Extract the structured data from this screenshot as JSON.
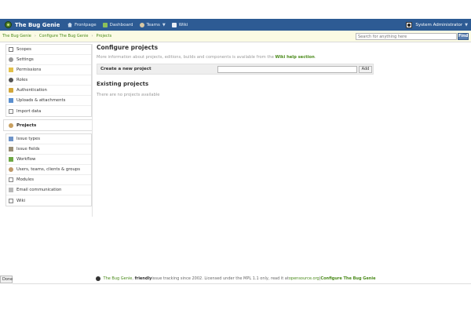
{
  "header": {
    "logo_text": "The Bug Genie",
    "nav": [
      {
        "label": "Frontpage"
      },
      {
        "label": "Dashboard"
      },
      {
        "label": "Teams"
      },
      {
        "label": "Wiki"
      }
    ],
    "user_label": "System Administrator"
  },
  "breadcrumb": {
    "items": [
      "The Bug Genie",
      "Configure The Bug Genie",
      "Projects"
    ],
    "separator": "›"
  },
  "search": {
    "placeholder": "Search for anything here",
    "button_label": "Find"
  },
  "sidebar": {
    "group1": [
      {
        "label": "Scopes",
        "icon": "scopes-icon"
      },
      {
        "label": "Settings",
        "icon": "settings-icon"
      },
      {
        "label": "Permissions",
        "icon": "permissions-icon"
      },
      {
        "label": "Roles",
        "icon": "roles-icon"
      },
      {
        "label": "Authentication",
        "icon": "lock-icon"
      },
      {
        "label": "Uploads & attachments",
        "icon": "upload-icon"
      },
      {
        "label": "Import data",
        "icon": "import-icon"
      }
    ],
    "selected": {
      "label": "Projects",
      "icon": "projects-icon"
    },
    "group2": [
      {
        "label": "Issue types",
        "icon": "issue-types-icon"
      },
      {
        "label": "Issue fields",
        "icon": "issue-fields-icon"
      },
      {
        "label": "Workflow",
        "icon": "workflow-icon"
      },
      {
        "label": "Users, teams, clients & groups",
        "icon": "users-icon"
      },
      {
        "label": "Modules",
        "icon": "modules-icon"
      },
      {
        "label": "Email communication",
        "icon": "email-icon"
      },
      {
        "label": "Wiki",
        "icon": "wiki-icon"
      }
    ]
  },
  "main": {
    "title": "Configure projects",
    "desc_prefix": "More information about projects, editions, builds and components is available from the ",
    "desc_link": "Wiki help section",
    "desc_suffix": ".",
    "create_label": "Create a new project",
    "add_label": "Add",
    "existing_title": "Existing projects",
    "empty_text": "There are no projects available"
  },
  "footer": {
    "brand": "The Bug Genie",
    "friendly": "friendly",
    "text1": " issue tracking since 2002. Licensed under the MPL 1.1 only, read it at ",
    "link": "opensource.org",
    "divider": " | ",
    "configure": "Configure The Bug Genie"
  },
  "status": {
    "text": "Done"
  },
  "colors": {
    "header": "#2d5b94",
    "link_green": "#4a8a1a",
    "crumb_bg": "#fbfbe4"
  }
}
